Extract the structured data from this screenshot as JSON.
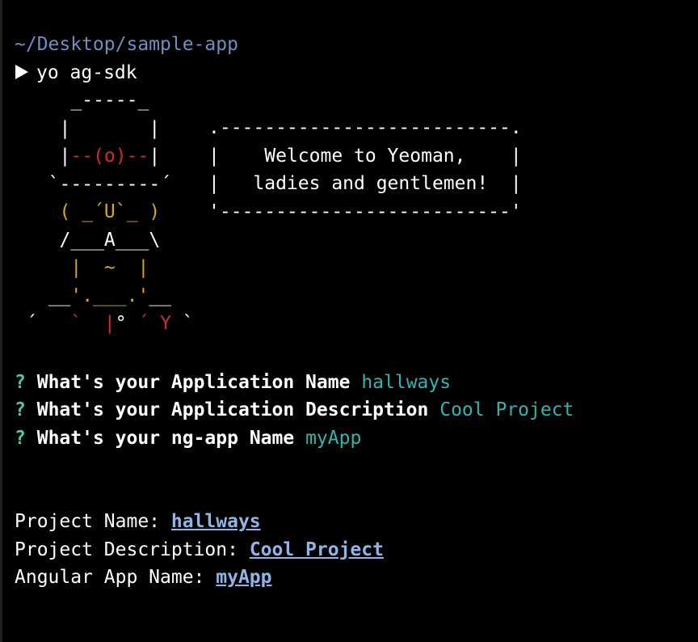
{
  "terminal": {
    "cwd": "~/Desktop/sample-app",
    "command": "yo ag-sdk"
  },
  "yeoman_art": {
    "robot_lines": [
      "    _-----_",
      "   |       |",
      "   |--(o)--|",
      "  `---------´",
      "   ( _´U`_ )",
      "   /___A___\\",
      "    |  ~  |",
      "  __'.___.'__",
      "´   `  |° ´ Y `"
    ],
    "bubble": {
      "top": ".--------------------------.",
      "line1": "|    Welcome to Yeoman,    |",
      "line2": "|   ladies and gentlemen!  |",
      "bottom": "'--------------------------'"
    }
  },
  "questions": [
    {
      "mark": "?",
      "label": "What's your Application Name",
      "answer": "hallways"
    },
    {
      "mark": "?",
      "label": "What's your Application Description",
      "answer": "Cool Project"
    },
    {
      "mark": "?",
      "label": "What's your ng-app Name",
      "answer": "myApp"
    }
  ],
  "summary": [
    {
      "label": "Project Name:",
      "value": "hallways"
    },
    {
      "label": "Project Description:",
      "value": "Cool Project"
    },
    {
      "label": "Angular App Name:",
      "value": "myApp"
    }
  ],
  "colors": {
    "background": "#000000",
    "path": "#6c8fc4",
    "question_mark": "#4ec9a4",
    "answer": "#2eb6b0",
    "link": "#8fb4e8",
    "art_red": "#d22a2a",
    "art_yellow": "#d6a81e"
  },
  "icons": {
    "prompt": "play-triangle-icon"
  }
}
